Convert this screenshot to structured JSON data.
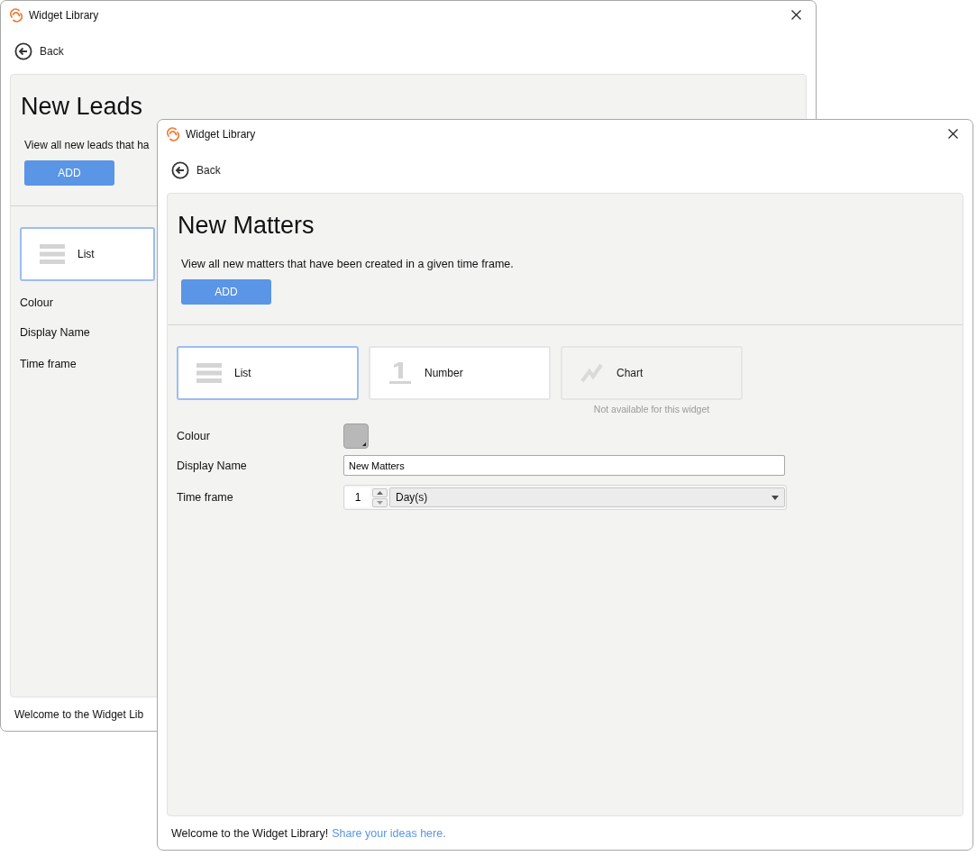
{
  "windows": [
    {
      "title": "Widget Library",
      "back": "Back",
      "heading": "New Leads",
      "description": "View all new leads that ha",
      "add_button": "ADD",
      "tiles": [
        {
          "kind": "list",
          "label": "List",
          "selected": true,
          "disabled": false
        }
      ],
      "fields": [
        {
          "kind": "colour",
          "label": "Colour"
        },
        {
          "kind": "text",
          "label": "Display Name"
        },
        {
          "kind": "timeframe",
          "label": "Time frame"
        }
      ],
      "footer": {
        "text": "Welcome to the Widget Lib"
      }
    },
    {
      "title": "Widget Library",
      "back": "Back",
      "heading": "New Matters",
      "description": "View all new matters that have been created in a given time frame.",
      "add_button": "ADD",
      "tiles": [
        {
          "kind": "list",
          "label": "List",
          "selected": true,
          "disabled": false
        },
        {
          "kind": "number",
          "label": "Number",
          "selected": false,
          "disabled": false
        },
        {
          "kind": "chart",
          "label": "Chart",
          "selected": false,
          "disabled": true,
          "note": "Not available for this widget"
        }
      ],
      "fields": [
        {
          "kind": "colour",
          "label": "Colour",
          "color": "#b8b8b8"
        },
        {
          "kind": "text",
          "label": "Display Name",
          "value": "New Matters"
        },
        {
          "kind": "timeframe",
          "label": "Time frame",
          "value": "1",
          "unit": "Day(s)"
        }
      ],
      "footer": {
        "text": "Welcome to the Widget Library!",
        "link": "Share your ideas here."
      }
    }
  ]
}
